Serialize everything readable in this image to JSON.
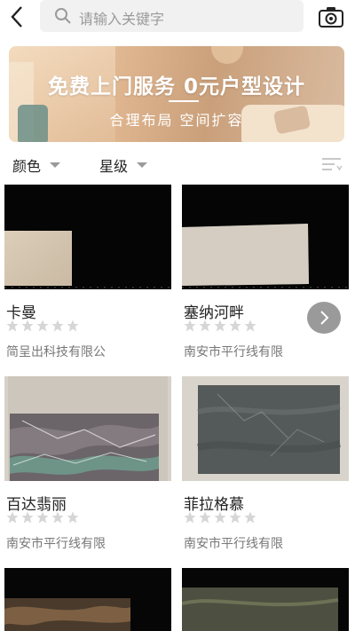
{
  "search": {
    "placeholder": "请输入关键字"
  },
  "banner": {
    "title": "免费上门服务  0元户型设计",
    "subtitle": "合理布局  空间扩容"
  },
  "filters": [
    {
      "label": "颜色"
    },
    {
      "label": "星级"
    }
  ],
  "products": [
    {
      "name": "卡曼",
      "rating": 0,
      "company": "简呈出科技有限公"
    },
    {
      "name": "塞纳河畔",
      "rating": 0,
      "company": "南安市平行线有限"
    },
    {
      "name": "百达翡丽",
      "rating": 0,
      "company": "南安市平行线有限"
    },
    {
      "name": "菲拉格慕",
      "rating": 0,
      "company": "南安市平行线有限"
    }
  ],
  "colors": {
    "star_inactive": "#d6d6d6",
    "background": "#ffffff",
    "search_bg": "#f1f1f1"
  },
  "icons": {
    "back": "chevron-left-icon",
    "search": "search-icon",
    "camera": "camera-icon",
    "sort": "sort-icon",
    "next": "chevron-right-icon"
  }
}
